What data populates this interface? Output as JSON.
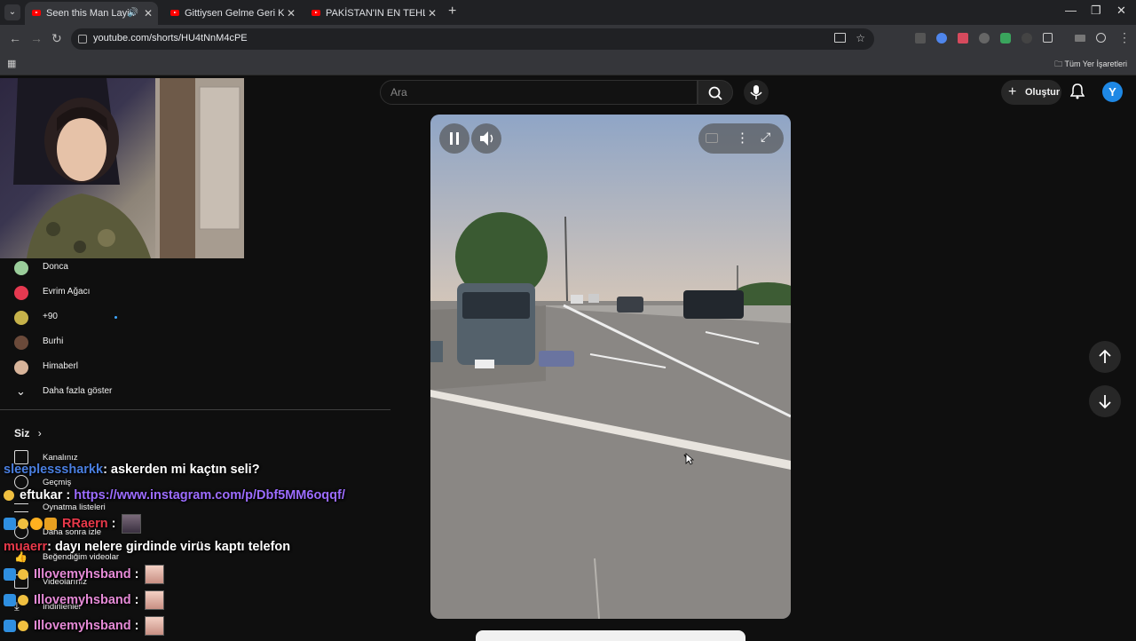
{
  "browser": {
    "tabs": [
      {
        "title": "Seen this Man Laying Down",
        "active": true,
        "audio": true
      },
      {
        "title": "Gittiysen Gelme Geri Kedi Versiy",
        "active": false
      },
      {
        "title": "PAKİSTAN'IN EN TEHLİKELİ MA",
        "active": false
      }
    ],
    "new_tab": "+",
    "close_glyph": "✕",
    "url": "youtube.com/shorts/HU4tNnM4cPE",
    "bookmarks_label": "Tüm Yer İşaretleri"
  },
  "header": {
    "search_placeholder": "Ara",
    "create_label": "Oluştur",
    "avatar_letter": "Y"
  },
  "sidebar": {
    "subscriptions": [
      {
        "name": "Donca",
        "color": "#9acd9a"
      },
      {
        "name": "Evrim Ağacı",
        "color": "#e53950"
      },
      {
        "name": "+90",
        "color": "#c6b24a",
        "new": true
      },
      {
        "name": "Burhi",
        "color": "#6b4a3a"
      },
      {
        "name": "Himaberl",
        "color": "#d8b49a"
      }
    ],
    "show_more": "Daha fazla göster",
    "you_label": "Siz",
    "library": [
      "Kanalınız",
      "Geçmiş",
      "Oynatma listeleri",
      "Daha sonra izle",
      "Beğendiğim videolar",
      "Videolarınız",
      "İndirilenler"
    ]
  },
  "chat": [
    {
      "user": "sleeplesssharkk",
      "color": "#4a7fe0",
      "text": ": askerden mi kaçtın seli?"
    },
    {
      "user": "eftukar",
      "color": "#ffffff",
      "sep": ":",
      "link": "https://www.instagram.com/p/Dbf5MM6oqqf/"
    },
    {
      "user": "RRaern",
      "color": "#e8394a",
      "text": ":"
    },
    {
      "user": "muaerr",
      "color": "#e8394a",
      "text": ": dayı nelere girdinde virüs kaptı telefon"
    },
    {
      "user": "Illovemyhsband",
      "color": "#e58ad6",
      "text": ":"
    },
    {
      "user": "Illovemyhsband",
      "color": "#e58ad6",
      "text": ":"
    },
    {
      "user": "Illovemyhsband",
      "color": "#e58ad6",
      "text": ":"
    }
  ],
  "short": {
    "colors": {
      "sky_top": "#8fa5c6",
      "sky_bottom": "#d8c8b8",
      "road": "#8a8784"
    }
  }
}
